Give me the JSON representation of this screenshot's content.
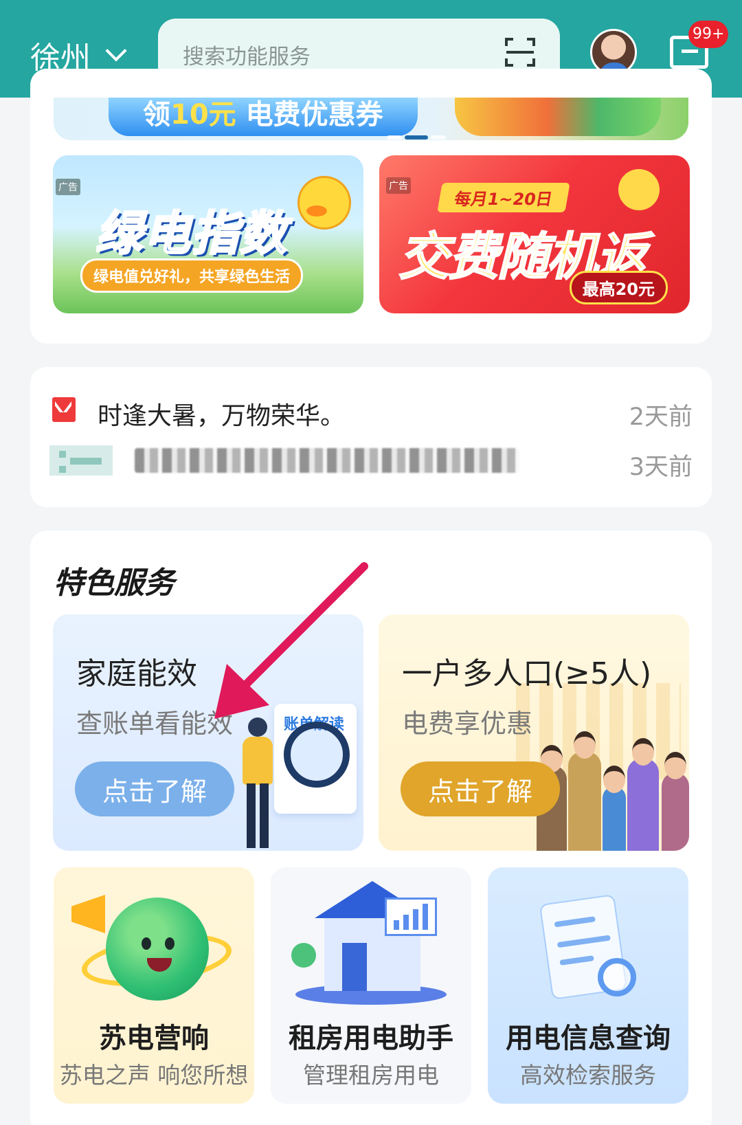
{
  "header": {
    "city": "徐州",
    "search_placeholder": "搜索功能服务",
    "message_badge": "99+"
  },
  "banner": {
    "coupon_prefix": "领",
    "coupon_amount": "10元",
    "coupon_suffix": "电费优惠券"
  },
  "ads": [
    {
      "tag": "广告",
      "title": "绿电指数",
      "subtitle": "绿电值兑好礼，共享绿色生活"
    },
    {
      "tag": "广告",
      "ribbon": "每月1~20日",
      "title": "交费随机返",
      "pill": "最高20元"
    }
  ],
  "notices": [
    {
      "text": "时逢大暑，万物荣华。",
      "time": "2天前"
    },
    {
      "text": "",
      "time": "3天前"
    }
  ],
  "services": {
    "title": "特色服务",
    "featured": [
      {
        "title": "家庭能效",
        "subtitle": "查账单看能效",
        "button": "点击了解",
        "illustration_label": "账单解读"
      },
      {
        "title": "一户多人口(≥5人)",
        "subtitle": "电费享优惠",
        "button": "点击了解"
      }
    ],
    "tiles": [
      {
        "title": "苏电营响",
        "subtitle": "苏电之声 响您所想"
      },
      {
        "title": "租房用电助手",
        "subtitle": "管理租房用电"
      },
      {
        "title": "用电信息查询",
        "subtitle": "高效检索服务"
      }
    ]
  },
  "colors": {
    "header_bg": "#25a6a0",
    "badge": "#e8212c",
    "annotation_arrow": "#e0195a",
    "button_blue": "#7bb0ea",
    "button_gold": "#e0a52a"
  },
  "icons": [
    "chevron-down-icon",
    "scan-icon",
    "customer-service-avatar",
    "message-icon",
    "envelope-icon"
  ]
}
